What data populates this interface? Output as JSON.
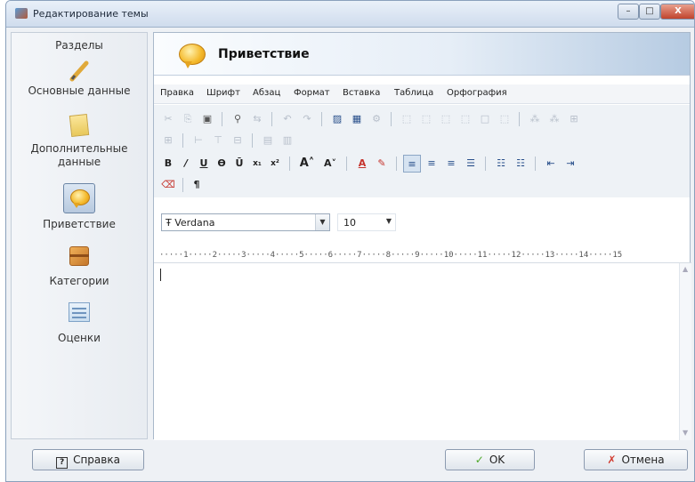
{
  "window": {
    "title": "Редактирование темы",
    "min_icon": "minimize-icon",
    "max_icon": "maximize-icon",
    "close_icon": "close-icon",
    "min_glyph": "–",
    "max_glyph": "□",
    "close_glyph": "X"
  },
  "sidebar": {
    "header": "Разделы",
    "items": [
      {
        "label": "Основные данные",
        "icon": "pencil-icon"
      },
      {
        "label": "Дополнительные данные",
        "icon": "note-icon"
      },
      {
        "label": "Приветствие",
        "icon": "speech-bubble-icon",
        "selected": true
      },
      {
        "label": "Категории",
        "icon": "box-icon"
      },
      {
        "label": "Оценки",
        "icon": "chart-icon"
      }
    ]
  },
  "header": {
    "title": "Приветствие",
    "icon": "speech-bubble-icon"
  },
  "menubar": {
    "items": [
      "Правка",
      "Шрифт",
      "Абзац",
      "Формат",
      "Вставка",
      "Таблица",
      "Орфография"
    ]
  },
  "toolbar": {
    "font_name": "Verdana",
    "font_size": "10",
    "font_glyph": "Ŧ",
    "bold_glyph": "B",
    "italic_glyph": "/",
    "underline_glyph": "U",
    "strike_glyph": "Ɵ",
    "overline_glyph": "Ū",
    "sub_glyph": "x₁",
    "sup_glyph": "x²",
    "grow_glyph": "A˄",
    "shrink_glyph": "A˅",
    "pilcrow_glyph": "¶",
    "dropdown_glyph": "▼"
  },
  "ruler": {
    "text": "·····1·····2·····3·····4·····5·····6·····7·····8·····9·····10·····11·····12·····13·····14·····15"
  },
  "footer": {
    "help_label": "Справка",
    "ok_label": "OK",
    "cancel_label": "Отмена",
    "help_glyph": "?",
    "ok_glyph": "✓",
    "cancel_glyph": "✗"
  },
  "colors": {
    "accent": "#4ea829",
    "cancel": "#d13a2e",
    "header_gradient_end": "#b6cbe2"
  }
}
